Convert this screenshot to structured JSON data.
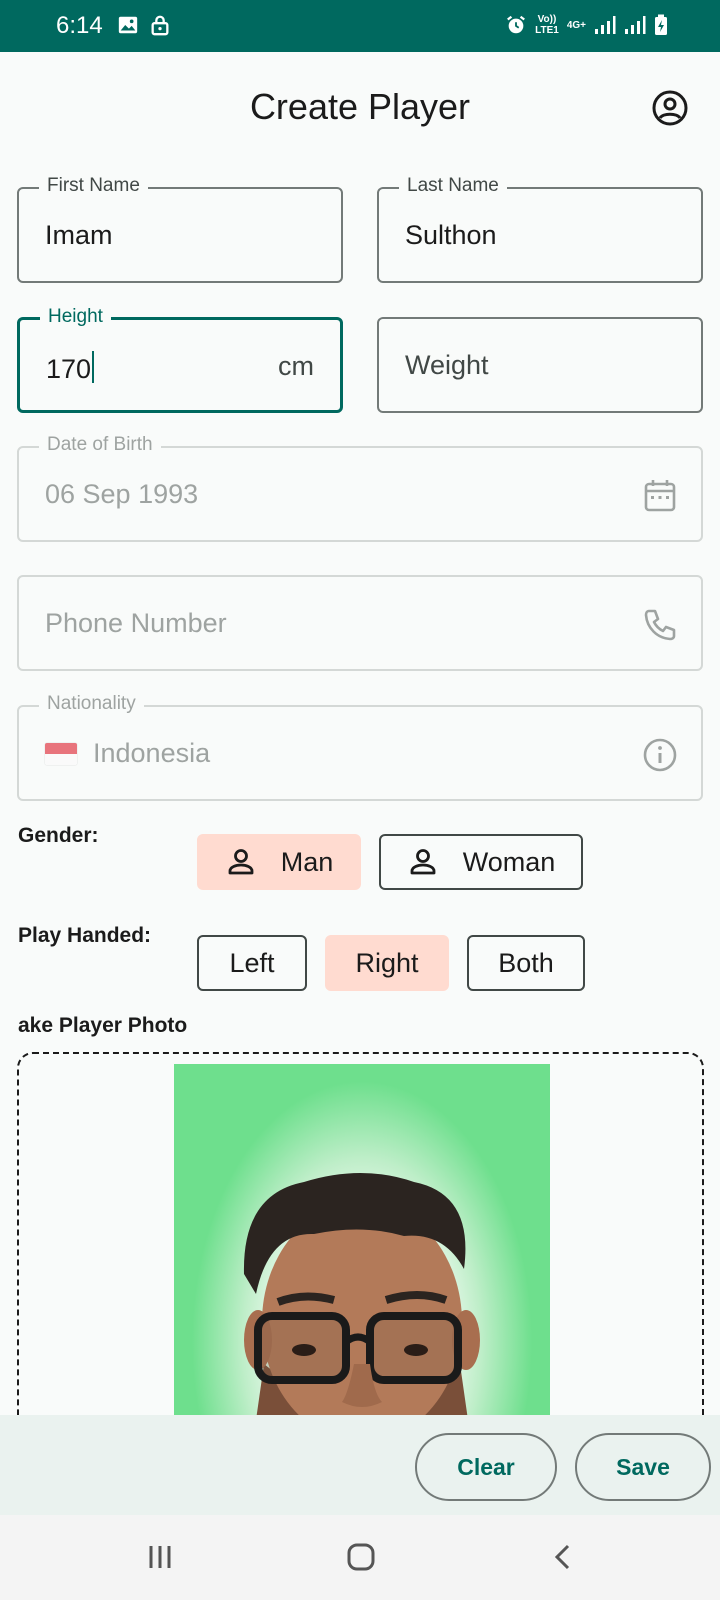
{
  "status_bar": {
    "time": "6:14",
    "network_top": "Vo))",
    "network_bottom": "LTE1",
    "network_type": "4G+",
    "icons": [
      "image-icon",
      "lock-icon",
      "alarm-icon",
      "signal-icon",
      "signal-icon",
      "battery-charging-icon"
    ]
  },
  "header": {
    "title": "Create Player",
    "account_icon": "account-circle-icon"
  },
  "form": {
    "first_name": {
      "label": "First Name",
      "value": "Imam"
    },
    "last_name": {
      "label": "Last Name",
      "value": "Sulthon"
    },
    "height": {
      "label": "Height",
      "value": "170",
      "suffix": "cm"
    },
    "weight": {
      "placeholder": "Weight"
    },
    "date_of_birth": {
      "label": "Date of Birth",
      "value": "06 Sep 1993",
      "icon": "calendar-icon"
    },
    "phone": {
      "placeholder": "Phone Number",
      "icon": "phone-icon"
    },
    "nationality": {
      "label": "Nationality",
      "value": "Indonesia",
      "icon": "info-icon"
    }
  },
  "gender": {
    "label": "Gender:",
    "options": [
      {
        "label": "Man",
        "selected": true
      },
      {
        "label": "Woman",
        "selected": false
      }
    ]
  },
  "play_handed": {
    "label": "Play Handed:",
    "options": [
      {
        "label": "Left",
        "selected": false
      },
      {
        "label": "Right",
        "selected": true
      },
      {
        "label": "Both",
        "selected": false
      }
    ]
  },
  "photo": {
    "label": "ake Player Photo"
  },
  "actions": {
    "clear_label": "Clear",
    "save_label": "Save"
  },
  "colors": {
    "primary": "#00695f",
    "selected_chip": "#ffdbd0",
    "status_bar": "#00695f"
  }
}
